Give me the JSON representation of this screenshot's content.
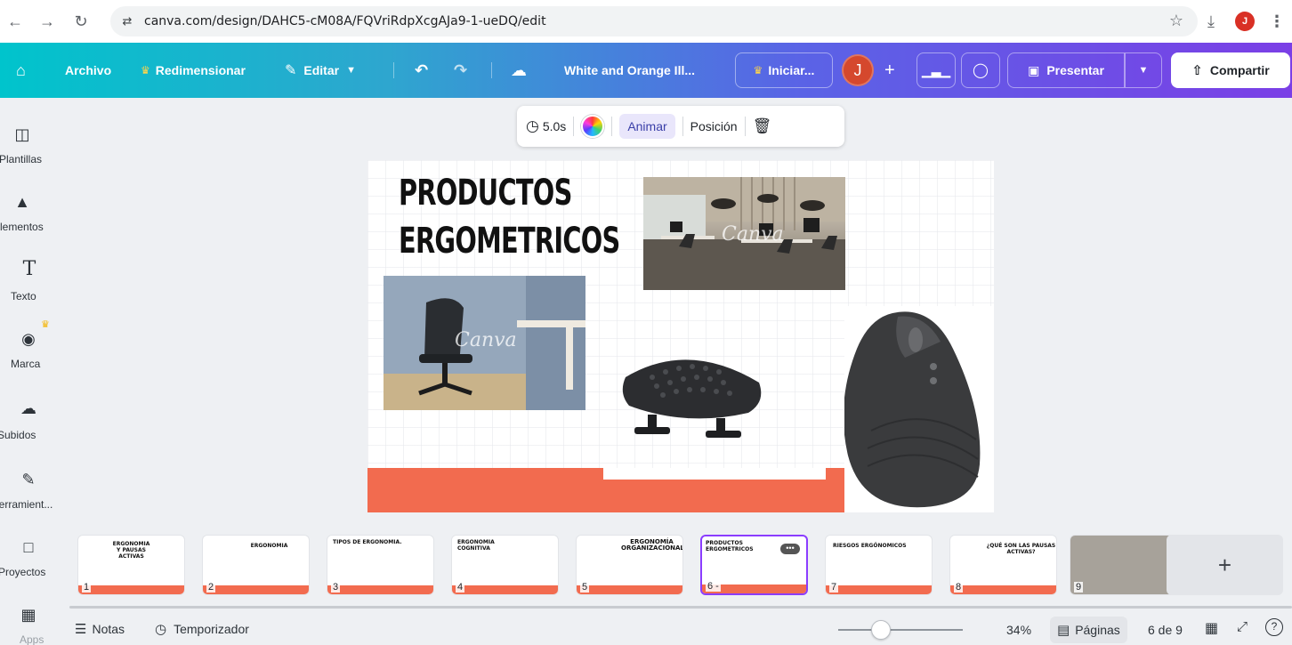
{
  "browser": {
    "url": "canva.com/design/DAHC5-cM08A/FQVriRdpXcgAJa9-1-ueDQ/edit",
    "profile_initial": "J"
  },
  "toolbar": {
    "archivo": "Archivo",
    "redimensionar": "Redimensionar",
    "editar": "Editar",
    "doc_title": "White and Orange Ill...",
    "iniciar": "Iniciar...",
    "avatar_initial": "J",
    "presentar": "Presentar",
    "compartir": "Compartir",
    "accent": "#7b3fe6"
  },
  "sidebar": {
    "items": [
      {
        "label": "Plantillas",
        "icon": "template-icon"
      },
      {
        "label": "Elementos",
        "icon": "elements-icon"
      },
      {
        "label": "Texto",
        "icon": "text-icon"
      },
      {
        "label": "Marca",
        "icon": "brand-icon"
      },
      {
        "label": "Subidos",
        "icon": "upload-icon"
      },
      {
        "label": "Herramient...",
        "icon": "tools-icon"
      },
      {
        "label": "Proyectos",
        "icon": "folder-icon"
      },
      {
        "label": "Apps",
        "icon": "apps-icon"
      }
    ]
  },
  "float_toolbar": {
    "duration": "5.0s",
    "animar": "Animar",
    "posicion": "Posición"
  },
  "slide": {
    "title_line1": "PRODUCTOS",
    "title_line2": "ERGOMETRICOS",
    "watermark": "Canva",
    "orange": "#f26b4f"
  },
  "thumbnails": [
    {
      "num": "1",
      "title": "ERGONOMIA Y PAUSAS ACTIVAS"
    },
    {
      "num": "2",
      "title": "ERGONOMIA"
    },
    {
      "num": "3",
      "title": "TIPOS DE ERGONOMIA."
    },
    {
      "num": "4",
      "title": "ERGONOMIA COGNITIVA"
    },
    {
      "num": "5",
      "title": "ERGONOMÍA ORGANIZACIONAL"
    },
    {
      "num": "6 -",
      "title": "PRODUCTOS ERGOMETRICOS"
    },
    {
      "num": "7",
      "title": "RIESGOS ERGÓNOMICOS"
    },
    {
      "num": "8",
      "title": "¿QUÉ SON LAS PAUSAS ACTIVAS?"
    },
    {
      "num": "9",
      "title": ""
    }
  ],
  "status": {
    "notas": "Notas",
    "temporizador": "Temporizador",
    "zoom": "34%",
    "zoom_fraction": 0.34,
    "paginas": "Páginas",
    "page_count": "6 de 9"
  }
}
